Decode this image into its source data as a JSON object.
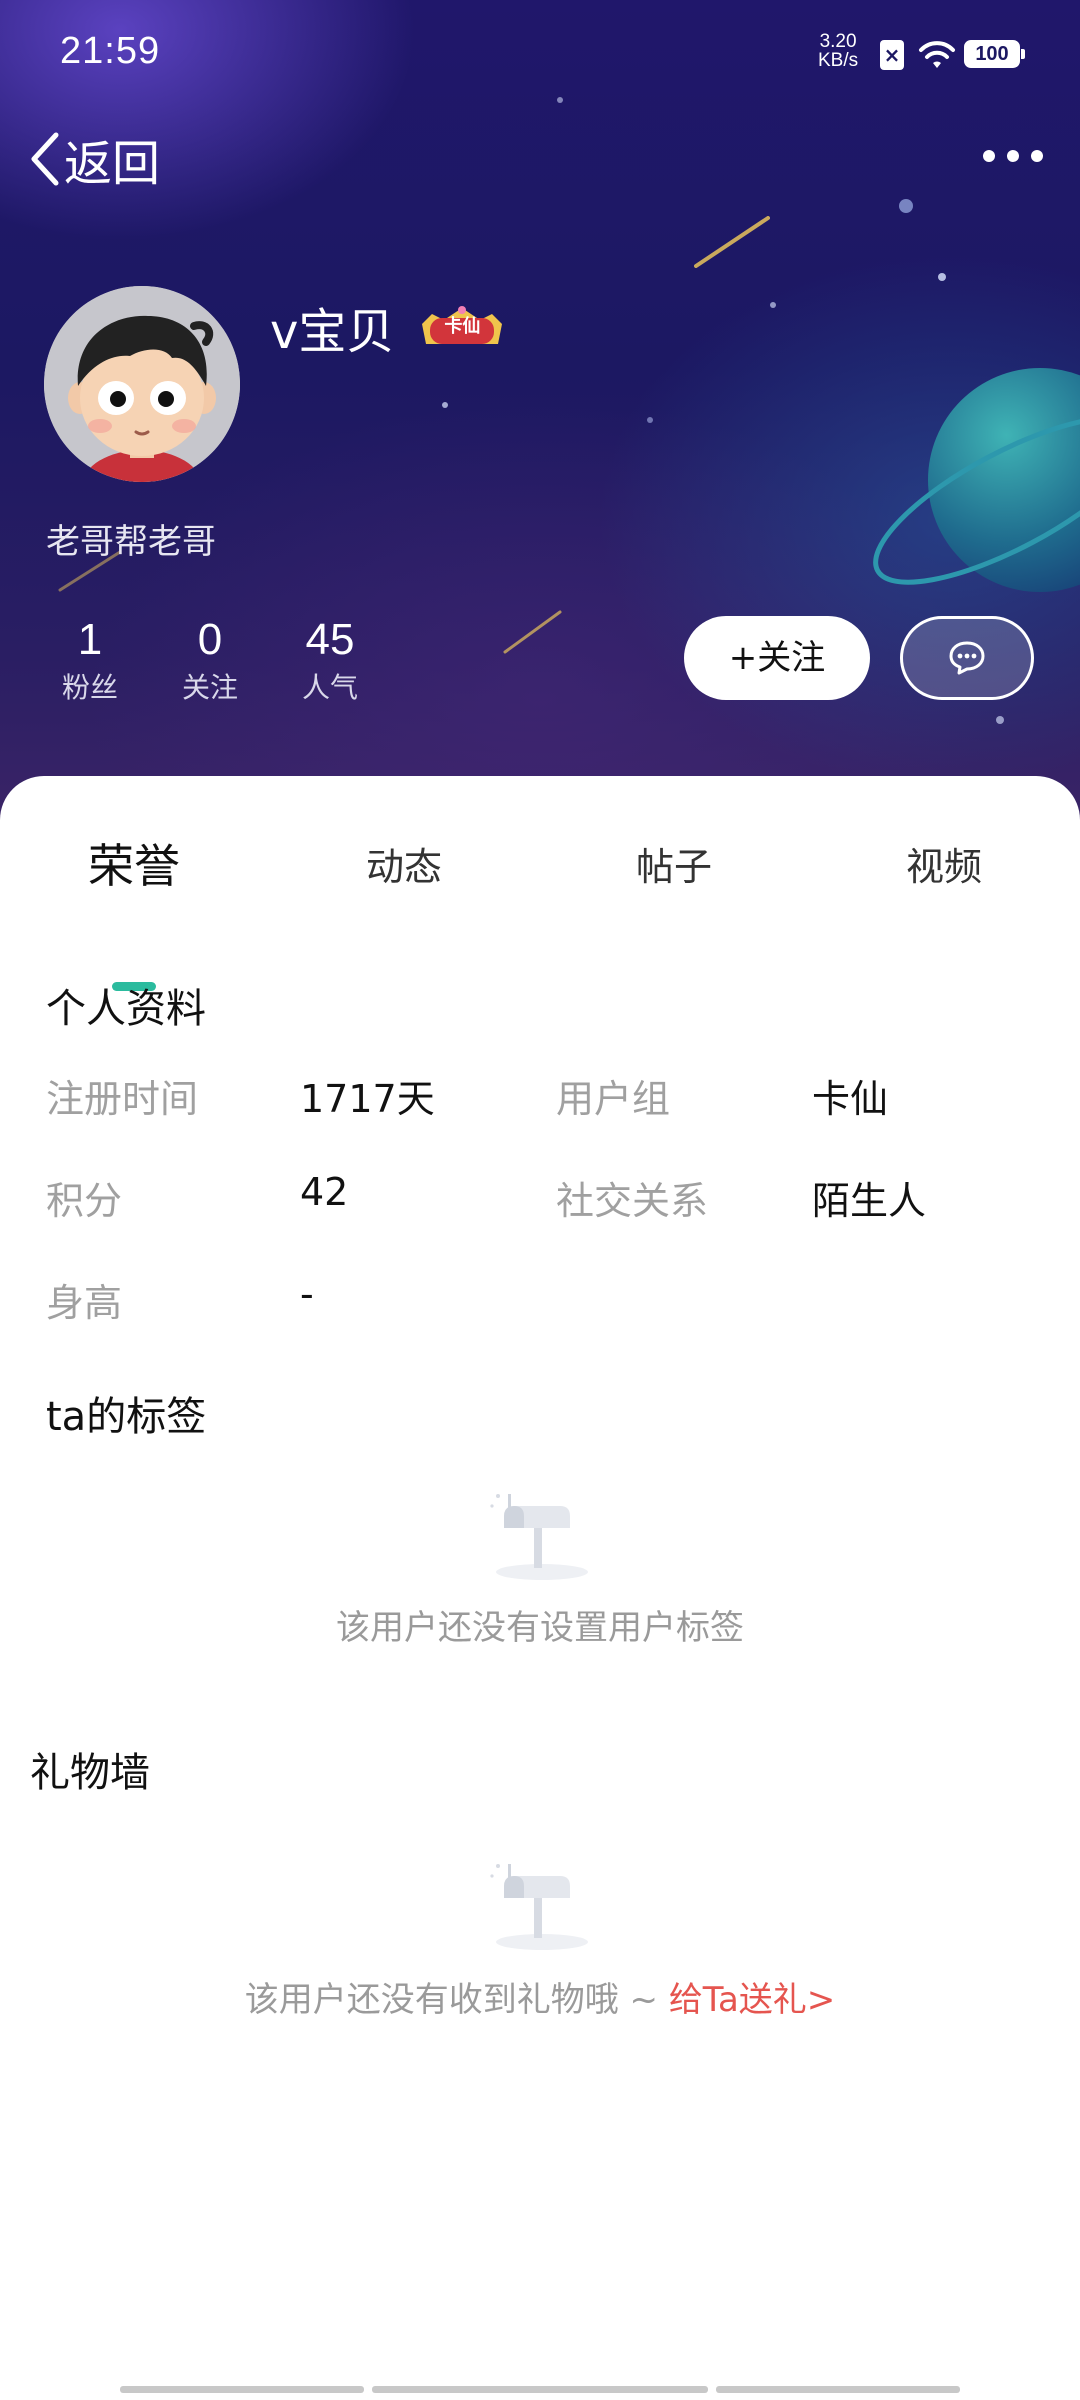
{
  "status_bar": {
    "time": "21:59",
    "net_speed_value": "3.20",
    "net_speed_unit": "KB/s",
    "battery": "100"
  },
  "nav": {
    "back_label": "返回"
  },
  "profile": {
    "username": "v宝贝",
    "badge_text": "卡仙",
    "bio": "老哥帮老哥",
    "stats": [
      {
        "value": "1",
        "label": "粉丝"
      },
      {
        "value": "0",
        "label": "关注"
      },
      {
        "value": "45",
        "label": "人气"
      }
    ],
    "follow_label": "+关注"
  },
  "tabs": [
    {
      "label": "荣誉",
      "active": true
    },
    {
      "label": "动态",
      "active": false
    },
    {
      "label": "帖子",
      "active": false
    },
    {
      "label": "视频",
      "active": false
    }
  ],
  "personal_info": {
    "title": "个人资料",
    "rows": [
      {
        "label": "注册时间",
        "value": "1717天",
        "label2": "用户组",
        "value2": "卡仙"
      },
      {
        "label": "积分",
        "value": "42",
        "label2": "社交关系",
        "value2": "陌生人"
      },
      {
        "label": "身高",
        "value": "-"
      }
    ]
  },
  "tags_section": {
    "title": "ta的标签",
    "empty_text": "该用户还没有设置用户标签"
  },
  "gift_section": {
    "title": "礼物墙",
    "empty_text": "该用户还没有收到礼物哦 ~ ",
    "link_text": "给Ta送礼>"
  },
  "colors": {
    "accent": "#2bbb9e",
    "link": "#e5554f",
    "header_bg": "#1c1862"
  },
  "icons": [
    "back-chevron-icon",
    "more-icon",
    "message-icon",
    "mailbox-icon",
    "wifi-icon",
    "close-icon",
    "battery-icon"
  ]
}
